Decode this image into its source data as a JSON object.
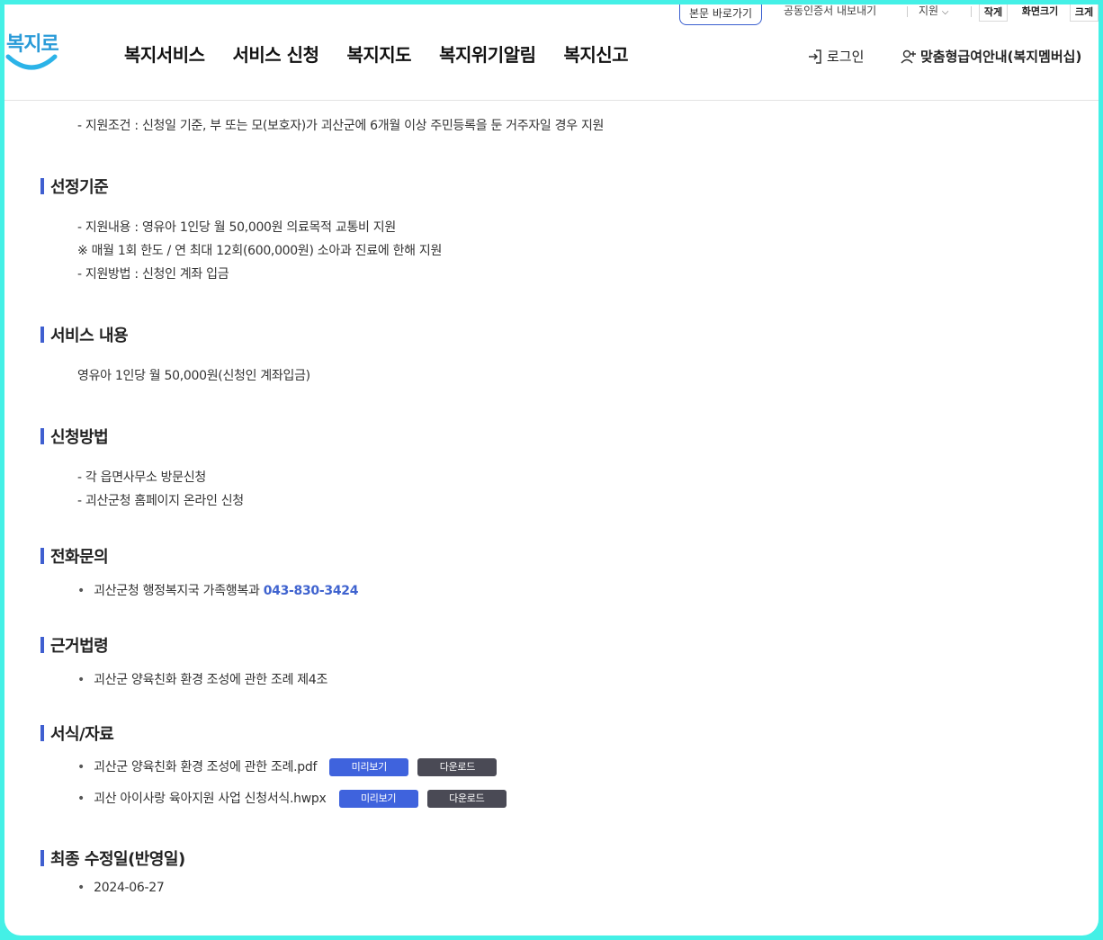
{
  "header": {
    "skip_link": "본문 바로가기",
    "cert_export": "공동인증서 내보내기",
    "support": "지원",
    "font_small": "작게",
    "font_size": "화면크기",
    "font_large": "크게",
    "logo": "복지로",
    "nav": [
      "복지서비스",
      "서비스 신청",
      "복지지도",
      "복지위기알림",
      "복지신고"
    ],
    "login": "로그인",
    "membership": "맞춤형급여안내(복지멤버십)"
  },
  "content": {
    "top_line": "- 지원조건 : 신청일 기준, 부 또는 모(보호자)가 괴산군에 6개월 이상 주민등록을 둔 거주자일 경우 지원",
    "sections": {
      "criteria": {
        "title": "선정기준",
        "lines": [
          "- 지원내용 : 영유아 1인당 월 50,000원 의료목적 교통비 지원",
          "※ 매월 1회 한도 / 연 최대 12회(600,000원) 소아과 진료에 한해 지원",
          "- 지원방법 : 신청인 계좌 입금"
        ]
      },
      "service": {
        "title": "서비스 내용",
        "text": "영유아 1인당 월 50,000원(신청인 계좌입금)"
      },
      "apply": {
        "title": "신청방법",
        "lines": [
          "- 각 읍면사무소 방문신청",
          "- 괴산군청 홈페이지 온라인 신청"
        ]
      },
      "contact": {
        "title": "전화문의",
        "dept": "괴산군청 행정복지국 가족행복과",
        "phone": "043-830-3424"
      },
      "law": {
        "title": "근거법령",
        "item": "괴산군 양육친화 환경 조성에 관한 조례 제4조"
      },
      "files": {
        "title": "서식/자료",
        "items": [
          {
            "name": "괴산군 양육친화 환경 조성에 관한 조례.pdf",
            "preview": "미리보기",
            "download": "다운로드"
          },
          {
            "name": "괴산 아이사랑 육아지원 사업 신청서식.hwpx",
            "preview": "미리보기",
            "download": "다운로드"
          }
        ]
      },
      "updated": {
        "title": "최종 수정일(반영일)",
        "date": "2024-06-27"
      }
    }
  }
}
